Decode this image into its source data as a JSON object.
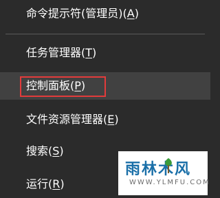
{
  "menu": {
    "items": [
      {
        "label": "命令提示符(管理员)(A)",
        "prefix": "命令提示符(管理员)(",
        "key": "A",
        "suffix": ")"
      },
      {
        "label": "任务管理器(T)",
        "prefix": "任务管理器(",
        "key": "T",
        "suffix": ")"
      },
      {
        "label": "控制面板(P)",
        "prefix": "控制面板(",
        "key": "P",
        "suffix": ")"
      },
      {
        "label": "文件资源管理器(E)",
        "prefix": "文件资源管理器(",
        "key": "E",
        "suffix": ")"
      },
      {
        "label": "搜索(S)",
        "prefix": "搜索(",
        "key": "S",
        "suffix": ")"
      },
      {
        "label": "运行(R)",
        "prefix": "运行(",
        "key": "R",
        "suffix": ")"
      }
    ]
  },
  "watermark": {
    "brand": "雨林木风",
    "url": "WWW.YLMFU.COM"
  },
  "colors": {
    "menu_bg": "#2b2b2b",
    "hover_bg": "#414141",
    "text": "#ffffff",
    "highlight_border": "#e33b3b",
    "watermark_brand": "#1a6fa8"
  }
}
